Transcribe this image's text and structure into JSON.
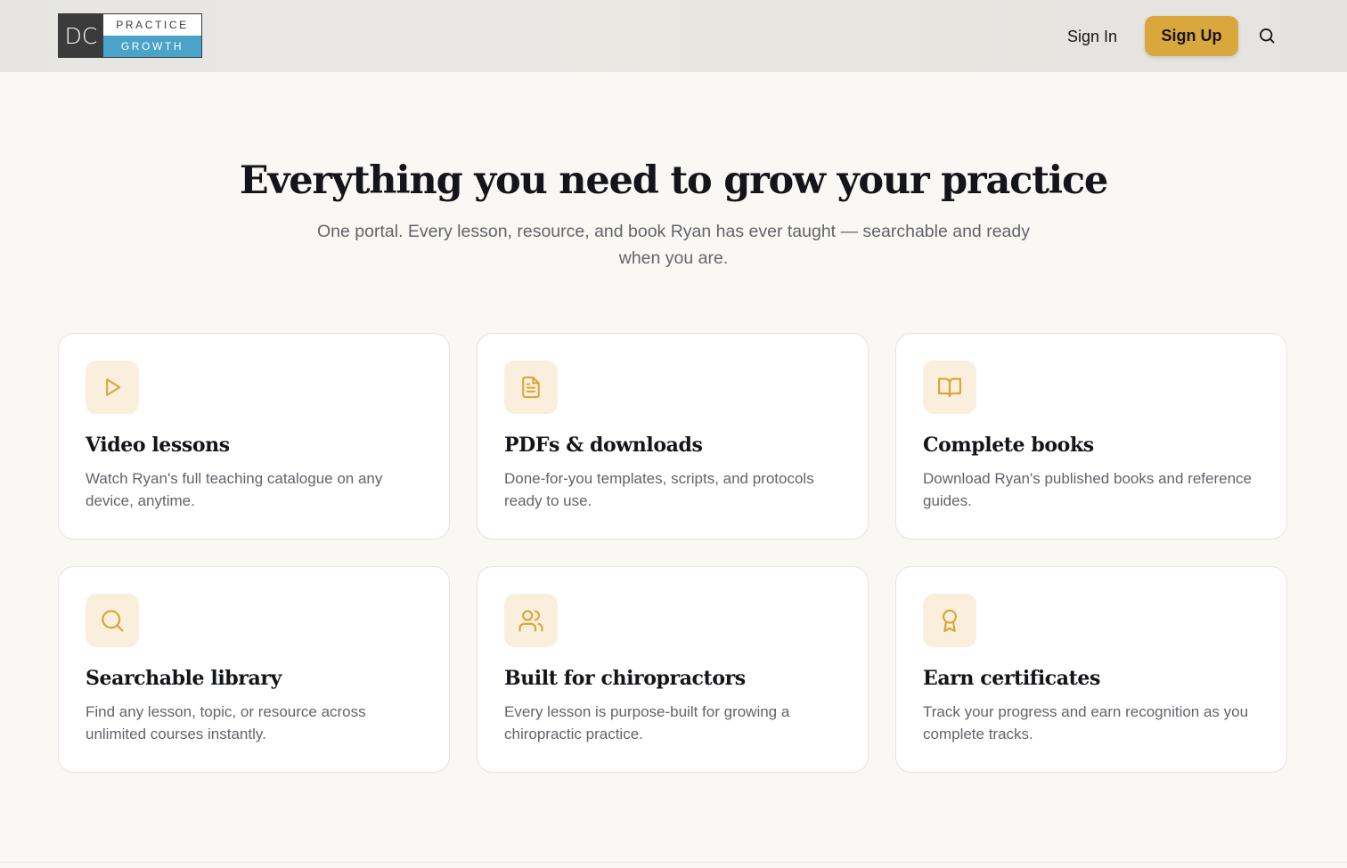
{
  "header": {
    "logo": {
      "initials": "DC",
      "top_text": "PRACTICE",
      "bottom_text": "GROWTH"
    },
    "sign_in_label": "Sign In",
    "sign_up_label": "Sign Up",
    "search_icon": "search-icon"
  },
  "hero": {
    "title": "Everything you need to grow your practice",
    "subtitle": "One portal. Every lesson, resource, and book Ryan has ever taught — searchable and ready when you are."
  },
  "features": [
    {
      "icon": "play-icon",
      "title": "Video lessons",
      "description": "Watch Ryan's full teaching catalogue on any device, anytime."
    },
    {
      "icon": "document-icon",
      "title": "PDFs & downloads",
      "description": "Done-for-you templates, scripts, and protocols ready to use."
    },
    {
      "icon": "book-icon",
      "title": "Complete books",
      "description": "Download Ryan's published books and reference guides."
    },
    {
      "icon": "search-icon",
      "title": "Searchable library",
      "description": "Find any lesson, topic, or resource across unlimited courses instantly."
    },
    {
      "icon": "users-icon",
      "title": "Built for chiropractors",
      "description": "Every lesson is purpose-built for growing a chiropractic practice."
    },
    {
      "icon": "award-icon",
      "title": "Earn certificates",
      "description": "Track your progress and earn recognition as you complete tracks."
    }
  ],
  "colors": {
    "accent": "#d9a73c",
    "icon_bg": "#faefdc",
    "logo_blue": "#4aa3c9",
    "logo_dark": "#3b3b3b",
    "page_bg": "#faf8f4"
  }
}
